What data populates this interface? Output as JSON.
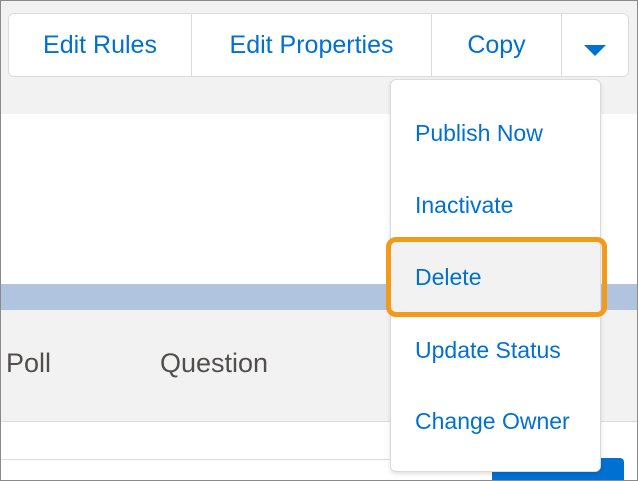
{
  "toolbar": {
    "edit_rules_label": "Edit Rules",
    "edit_properties_label": "Edit Properties",
    "copy_label": "Copy"
  },
  "menu": {
    "items": [
      {
        "label": "Publish Now"
      },
      {
        "label": "Inactivate"
      },
      {
        "label": "Delete",
        "highlighted": true
      },
      {
        "label": "Update Status"
      },
      {
        "label": "Change Owner"
      }
    ]
  },
  "table": {
    "columns": [
      "Poll",
      "Question"
    ]
  },
  "colors": {
    "link_blue": "#0070d2",
    "highlight_orange": "#f39a1b",
    "band_blue": "#b0c4df",
    "neutral_bg": "#f3f2f2"
  },
  "icons": {
    "more_actions": "chevron-down-icon"
  }
}
